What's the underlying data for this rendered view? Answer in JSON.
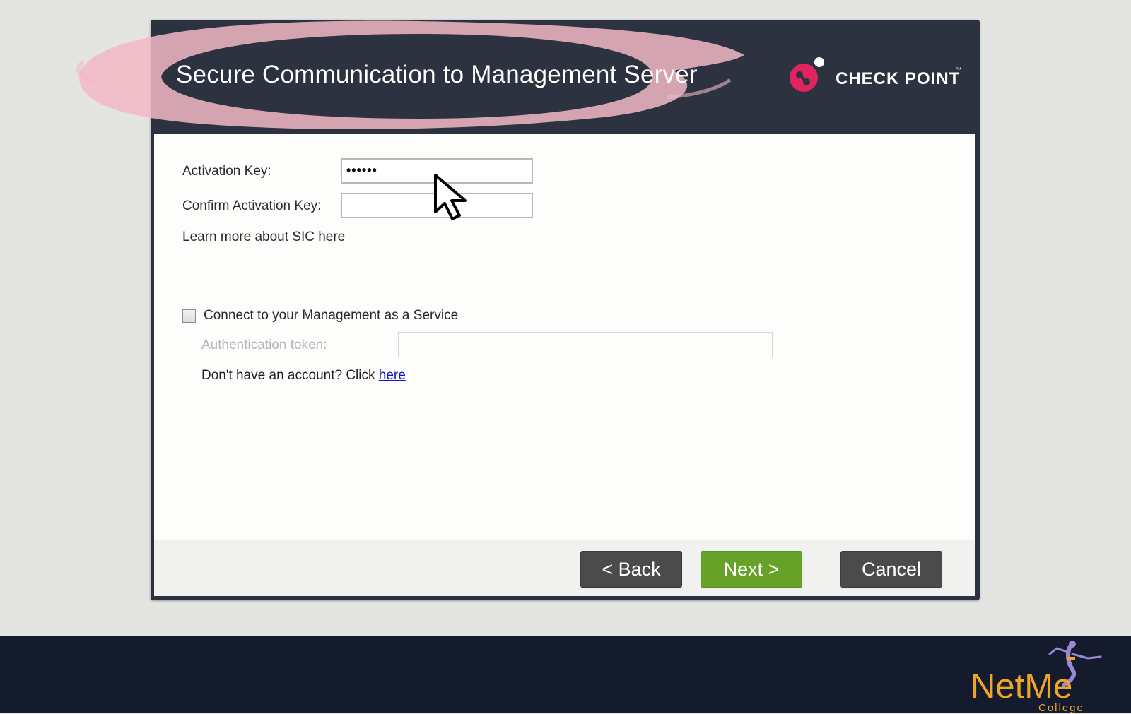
{
  "dialog": {
    "title": "Secure Communication to Management Server",
    "logo_text": "CHECK POINT",
    "logo_tm": "™",
    "activation_key_label": "Activation Key:",
    "activation_key_value": "••••••",
    "confirm_key_label": "Confirm Activation Key:",
    "confirm_key_value": "",
    "learn_more_link": "Learn more about SIC here",
    "maas_checkbox_label": "Connect to your Management as a Service",
    "maas_checked": false,
    "auth_token_label": "Authentication token:",
    "auth_token_value": "",
    "no_account_text": "Don't have an account? Click ",
    "no_account_link": "here"
  },
  "footer": {
    "back_label": "< Back",
    "next_label": "Next >",
    "cancel_label": "Cancel"
  },
  "branding": {
    "name": "NetMe",
    "sub": "College"
  },
  "colors": {
    "header_bg": "#2c3240",
    "highlight_brush": "#f2b8c6",
    "logo_accent": "#e0245e",
    "next_button": "#66a227",
    "dark_button": "#4a4c4b",
    "link": "#1414c8",
    "brand_orange": "#f0a524",
    "bottom_bar": "#131b2d"
  },
  "icons": {
    "logo": "check-point-logo-icon",
    "cursor": "mouse-pointer-icon",
    "brand_figure": "genie-figure-icon"
  }
}
